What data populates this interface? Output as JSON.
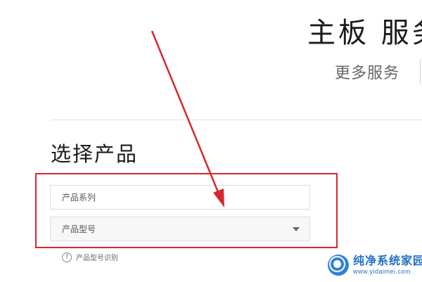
{
  "header": {
    "title": "主板 服务",
    "more_services": "更多服务"
  },
  "selection": {
    "section_title": "选择产品",
    "series_placeholder": "产品系列",
    "model_placeholder": "产品型号",
    "identify_link": "产品型号识别",
    "help_icon_glyph": "?"
  },
  "annotation": {
    "color": "#d8262f"
  },
  "watermark": {
    "name": "纯净系统家园",
    "url": "www.yidaimei.com"
  }
}
